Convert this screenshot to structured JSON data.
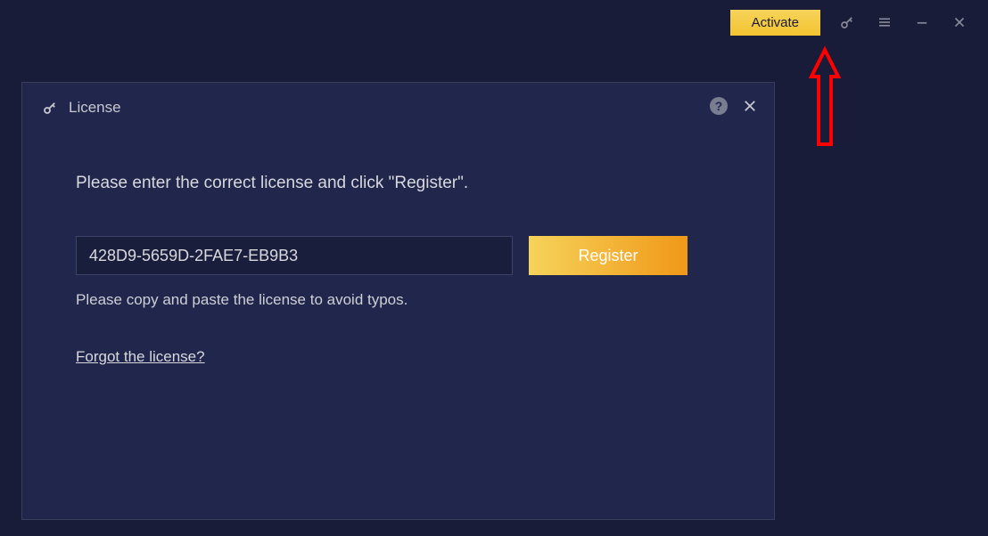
{
  "titlebar": {
    "activate_label": "Activate"
  },
  "dialog": {
    "title": "License",
    "instruction": "Please enter the correct license and click \"Register\".",
    "license_value": "428D9-5659D-2FAE7-EB9B3",
    "register_label": "Register",
    "helper_text": "Please copy and paste the license to avoid typos.",
    "forgot_link": "Forgot the license?",
    "help_tooltip": "?"
  }
}
